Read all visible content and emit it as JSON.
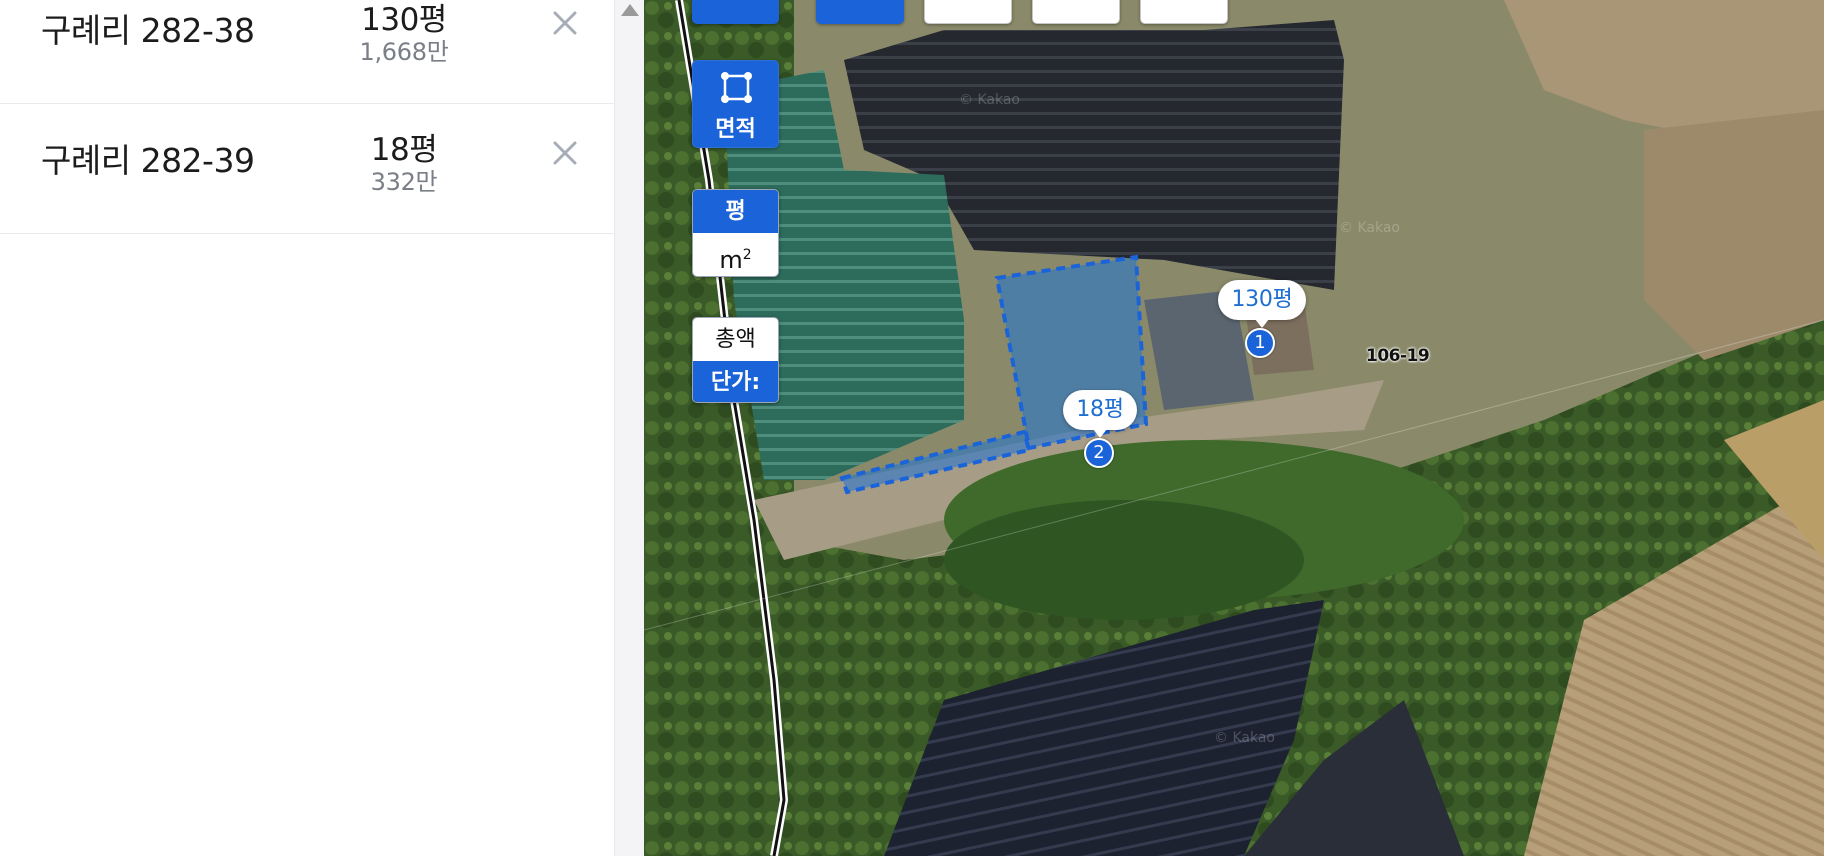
{
  "parcels": [
    {
      "address": "구례리 282-38",
      "area": "130평",
      "price": "1,668만"
    },
    {
      "address": "구례리 282-39",
      "area": "18평",
      "price": "332만"
    }
  ],
  "map_controls": {
    "area_label": "면적",
    "unit_pyeong": "평",
    "unit_m2": "m",
    "unit_m2_sup": "2",
    "price_total": "총액",
    "price_unit": "단가:"
  },
  "map_labels": {
    "parcel1_area": "130평",
    "parcel1_num": "1",
    "parcel2_area": "18평",
    "parcel2_num": "2",
    "lot_number": "106-19",
    "watermark": "© Kakao"
  },
  "colors": {
    "accent": "#1a63d8",
    "selection_fill": "#1f74d6",
    "close_icon": "#a7adb6"
  },
  "icons": {
    "close": "close-icon",
    "area": "area-polygon-icon",
    "scroll_up": "scroll-up-arrow-icon"
  }
}
